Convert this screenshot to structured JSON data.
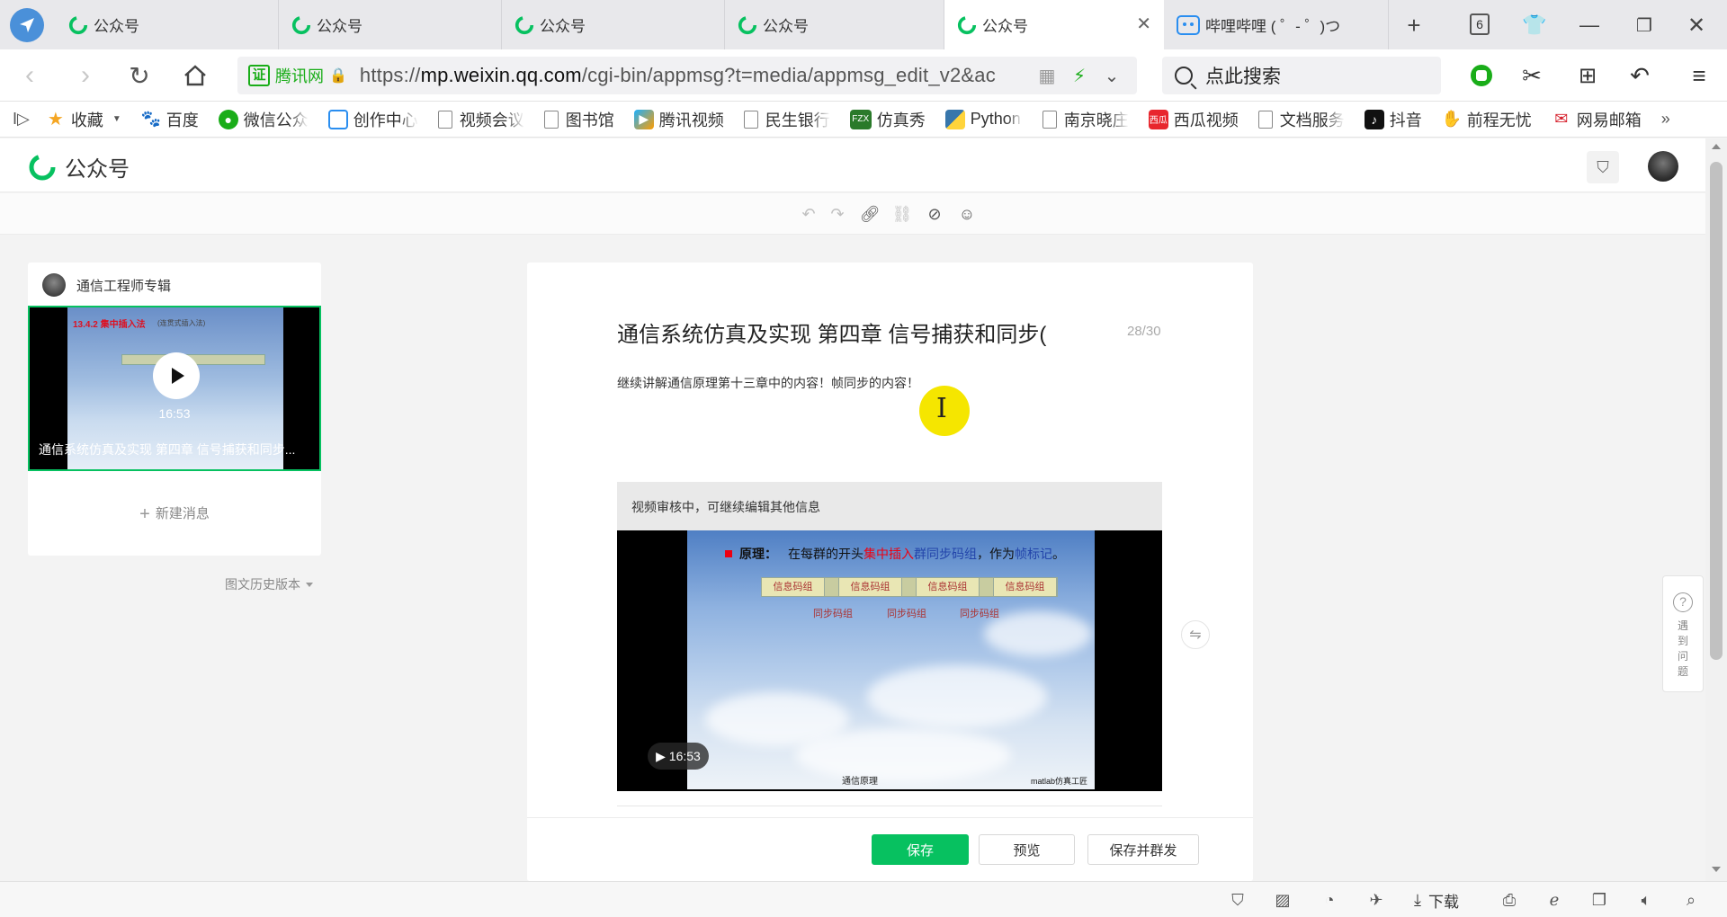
{
  "tabs": [
    {
      "label": "公众号"
    },
    {
      "label": "公众号"
    },
    {
      "label": "公众号"
    },
    {
      "label": "公众号"
    },
    {
      "label": "公众号"
    },
    {
      "label": "哔哩哔哩 ( ゜- ゜)つ"
    }
  ],
  "tab_count": "6",
  "address": {
    "cert_label": "腾讯网",
    "url_prefix": "https://",
    "url_host": "mp.weixin.qq.com",
    "url_path": "/cgi-bin/appmsg?t=media/appmsg_edit_v2&ac",
    "search_placeholder": "点此搜索"
  },
  "bookmarks": [
    {
      "label": "收藏",
      "icon": "star-icon"
    },
    {
      "label": "百度",
      "icon": "baidu-icon"
    },
    {
      "label": "微信公众",
      "icon": "wechat-icon"
    },
    {
      "label": "创作中心",
      "icon": "bilibili-icon"
    },
    {
      "label": "视频会议",
      "icon": "doc-icon"
    },
    {
      "label": "图书馆",
      "icon": "doc-icon"
    },
    {
      "label": "腾讯视频",
      "icon": "tencent-video-icon"
    },
    {
      "label": "民生银行",
      "icon": "doc-icon"
    },
    {
      "label": "仿真秀",
      "icon": "fzx-icon"
    },
    {
      "label": "Python",
      "icon": "python-icon"
    },
    {
      "label": "南京晓庄",
      "icon": "doc-icon"
    },
    {
      "label": "西瓜视频",
      "icon": "xigua-icon"
    },
    {
      "label": "文档服务",
      "icon": "doc-icon"
    },
    {
      "label": "抖音",
      "icon": "douyin-icon"
    },
    {
      "label": "前程无忧",
      "icon": "51job-icon"
    },
    {
      "label": "网易邮箱",
      "icon": "netease-mail-icon"
    }
  ],
  "app": {
    "name": "公众号"
  },
  "left_panel": {
    "account_name": "通信工程师专辑",
    "card_duration": "16:53",
    "card_title": "通信系统仿真及实现 第四章 信号捕获和同步...",
    "thumb_heading": "13.4.2 集中插入法",
    "thumb_sub": "(连贯式插入法)",
    "new_message": "新建消息",
    "history_label": "图文历史版本"
  },
  "editor": {
    "title": "通信系统仿真及实现 第四章 信号捕获和同步(",
    "title_count": "28/30",
    "summary": "继续讲解通信原理第十三章中的内容！帧同步的内容！",
    "video_notice": "视频审核中，可继续编辑其他信息",
    "video_duration": "16:53",
    "slide": {
      "principle_label": "原理：",
      "principle_text_a": "在每群的开头",
      "principle_text_b": "集中插入",
      "principle_text_c": "群同步码组",
      "principle_text_d": "，作为",
      "principle_text_e": "帧标记",
      "principle_text_f": "。",
      "segments": [
        "信息码组",
        "信息码组",
        "信息码组",
        "信息码组"
      ],
      "sync_labels": [
        "同步码组",
        "同步码组",
        "同步码组"
      ],
      "footer_left": "通信原理",
      "footer_right": "matlab仿真工匠"
    },
    "buttons": {
      "save": "保存",
      "preview": "预览",
      "save_publish": "保存并群发"
    }
  },
  "help": {
    "label": "遇到问题"
  },
  "statusbar": {
    "download_label": "下载"
  },
  "colors": {
    "accent": "#07c160",
    "tab_bar": "#e8e8eb",
    "cursor_highlight": "#f5e600"
  }
}
